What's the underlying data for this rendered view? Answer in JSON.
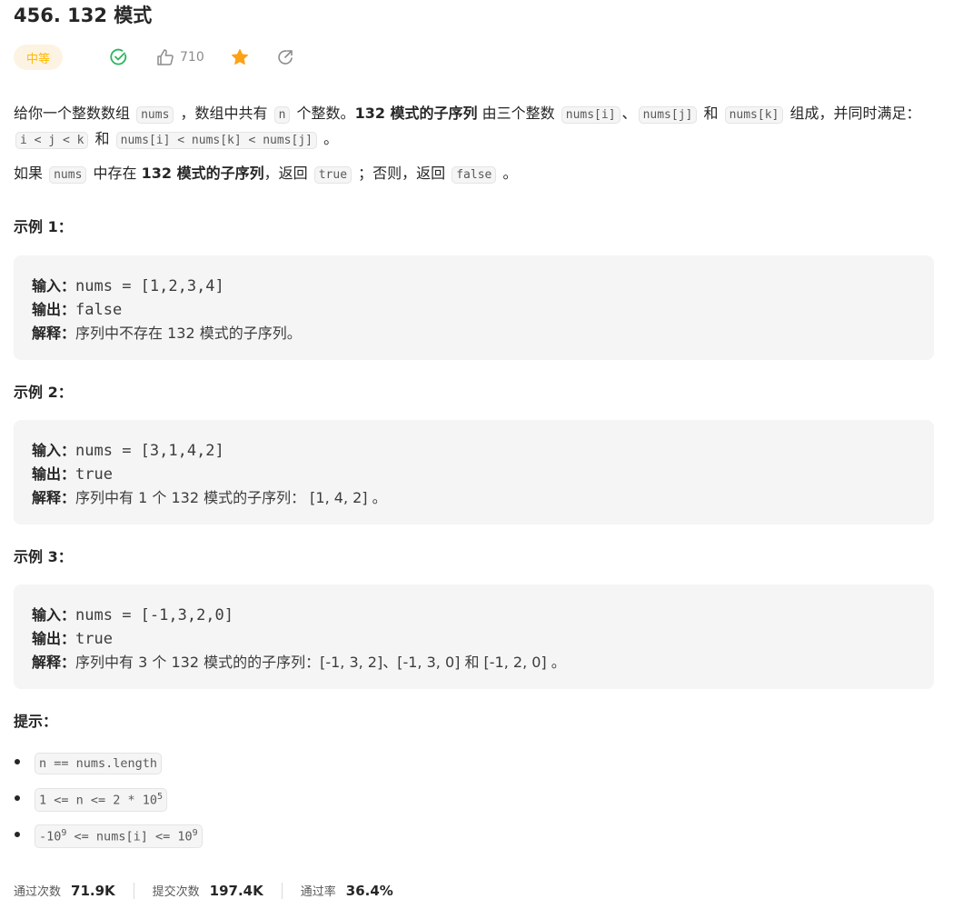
{
  "problem": {
    "title": "456. 132 模式",
    "difficulty": "中等",
    "like_count": "710"
  },
  "description": {
    "p1_a": "给你一个整数数组",
    "p1_code1": "nums",
    "p1_b": "，数组中共有",
    "p1_code2": "n",
    "p1_c": "个整数。",
    "p1_bold": "132 模式的子序列",
    "p1_d": "由三个整数",
    "p1_code3": "nums[i]",
    "p1_e": "、",
    "p1_code4": "nums[j]",
    "p1_f": "和",
    "p1_code5": "nums[k]",
    "p1_g": "组成，并同时满足：",
    "p1_code6": "i < j < k",
    "p1_h": "和",
    "p1_code7": "nums[i] < nums[k] < nums[j]",
    "p1_i": "。",
    "p2_a": "如果",
    "p2_code1": "nums",
    "p2_b": "中存在",
    "p2_bold": "132 模式的子序列",
    "p2_c": "，返回",
    "p2_code2": "true",
    "p2_d": "；否则，返回",
    "p2_code3": "false",
    "p2_e": "。"
  },
  "examples": [
    {
      "title": "示例 1：",
      "input_label": "输入：",
      "input": "nums = [1,2,3,4]",
      "output_label": "输出：",
      "output": "false",
      "explain_label": "解释：",
      "explain": "序列中不存在 132 模式的子序列。"
    },
    {
      "title": "示例 2：",
      "input_label": "输入：",
      "input": "nums = [3,1,4,2]",
      "output_label": "输出：",
      "output": "true",
      "explain_label": "解释：",
      "explain": "序列中有 1 个 132 模式的子序列： [1, 4, 2] 。"
    },
    {
      "title": "示例 3：",
      "input_label": "输入：",
      "input": "nums = [-1,3,2,0]",
      "output_label": "输出：",
      "output": "true",
      "explain_label": "解释：",
      "explain": "序列中有 3 个 132 模式的的子序列：[-1, 3, 2]、[-1, 3, 0] 和 [-1, 2, 0] 。"
    }
  ],
  "hints": {
    "title": "提示：",
    "h1": "n == nums.length",
    "h2_base": "1 <= n <= 2 * 10",
    "h2_exp": "5",
    "h3_a": "-10",
    "h3_exp1": "9",
    "h3_b": " <= nums[i] <= 10",
    "h3_exp2": "9"
  },
  "stats": {
    "accepted_label": "通过次数",
    "accepted": "71.9K",
    "submissions_label": "提交次数",
    "submissions": "197.4K",
    "rate_label": "通过率",
    "rate": "36.4%"
  },
  "colors": {
    "difficulty_text": "#ffb800",
    "difficulty_bg": "#fdf3e3",
    "solved_green": "#2db55d",
    "star_orange": "#ffa116"
  },
  "icons": [
    "solved-check-icon",
    "thumbs-up-icon",
    "star-icon",
    "share-icon"
  ]
}
